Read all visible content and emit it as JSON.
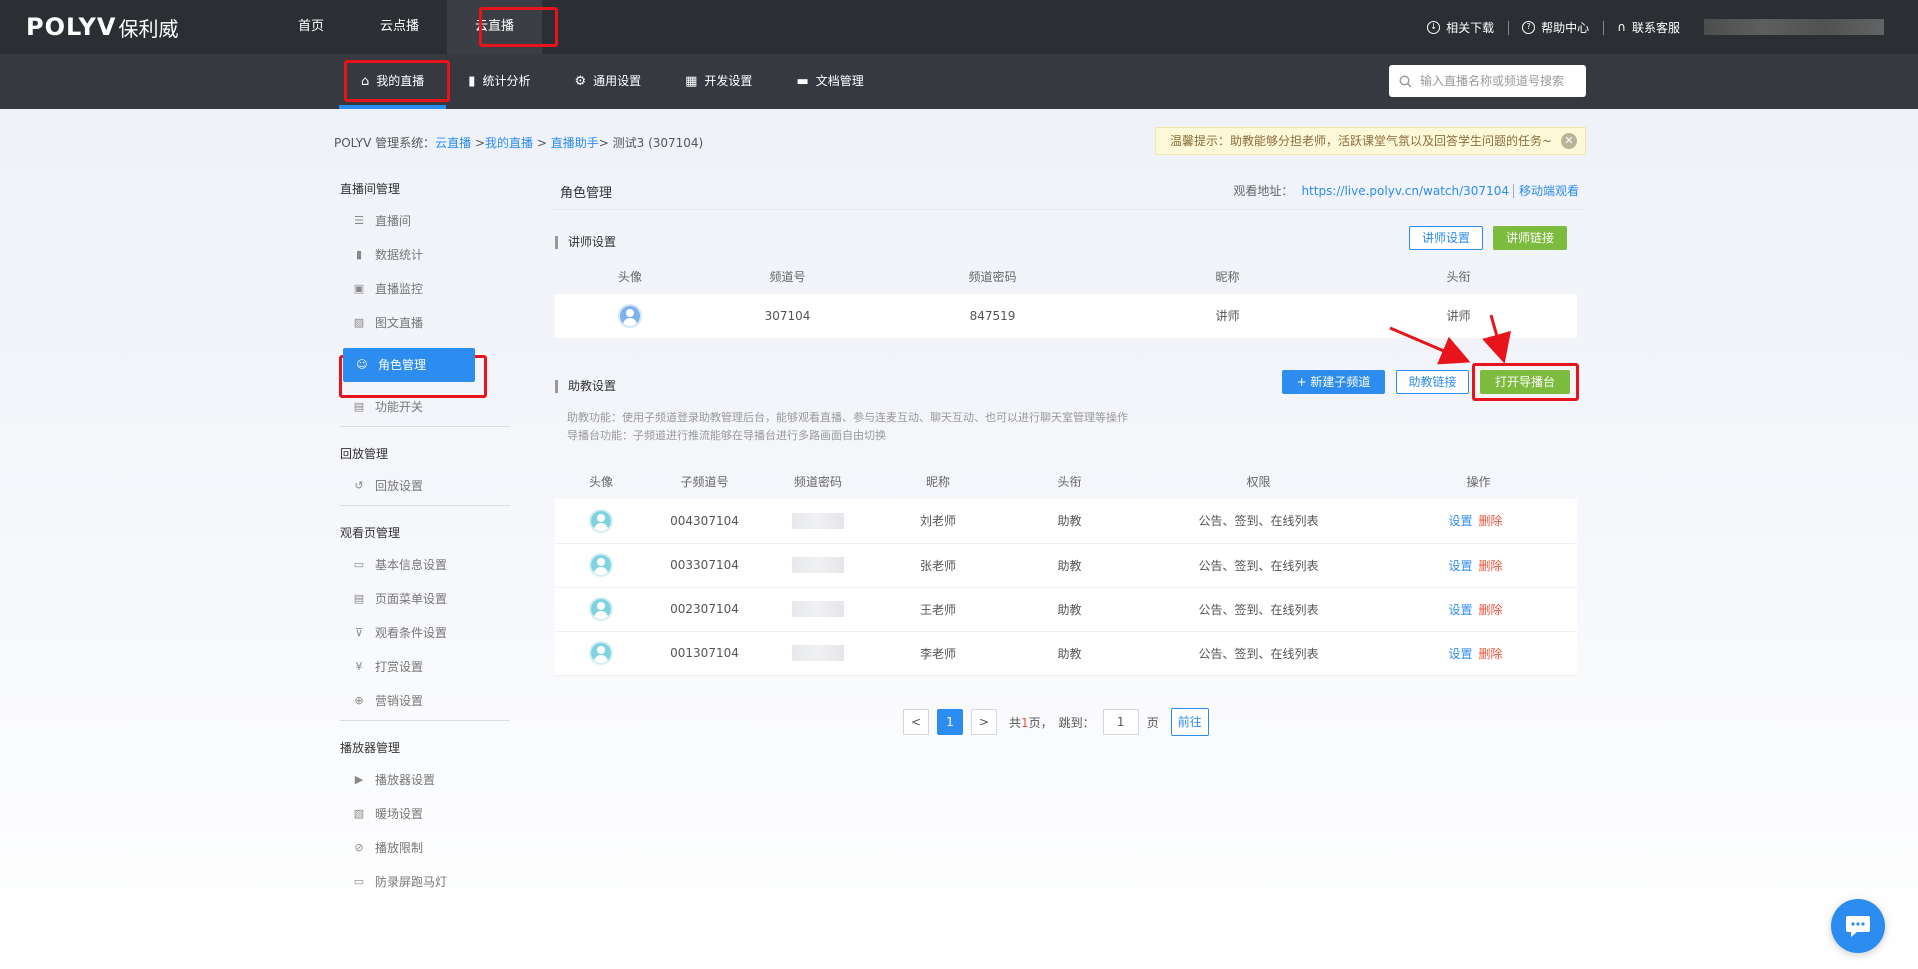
{
  "brand": {
    "logo": "POLYV",
    "logo_cn": "保利威"
  },
  "topnav": [
    "首页",
    "云点播",
    "云直播"
  ],
  "topright": {
    "download": "相关下载",
    "help": "帮助中心",
    "service": "联系客服"
  },
  "subnav": [
    "我的直播",
    "统计分析",
    "通用设置",
    "开发设置",
    "文档管理"
  ],
  "search": {
    "placeholder": "输入直播名称或频道号搜索"
  },
  "breadcrumb": {
    "prefix": "POLYV 管理系统：",
    "c1": "云直播",
    "sep1": " >",
    "c2": "我的直播",
    "sep2": " > ",
    "c3": "直播助手",
    "current": "> 测试3 (307104)"
  },
  "tip": {
    "text": "温馨提示：助教能够分担老师，活跃课堂气氛以及回答学生问题的任务~",
    "close": "✕"
  },
  "sidebar": {
    "groups": [
      {
        "title": "直播间管理",
        "items": [
          {
            "icon": "list-icon",
            "label": "直播间"
          },
          {
            "icon": "bar-chart-icon",
            "label": "数据统计"
          },
          {
            "icon": "monitor-icon",
            "label": "直播监控"
          },
          {
            "icon": "image-icon",
            "label": "图文直播"
          },
          {
            "icon": "user-icon",
            "label": "角色管理"
          },
          {
            "icon": "switch-icon",
            "label": "功能开关"
          }
        ]
      },
      {
        "title": "回放管理",
        "items": [
          {
            "icon": "replay-icon",
            "label": "回放设置"
          }
        ]
      },
      {
        "title": "观看页管理",
        "items": [
          {
            "icon": "info-icon",
            "label": "基本信息设置"
          },
          {
            "icon": "menu-icon",
            "label": "页面菜单设置"
          },
          {
            "icon": "filter-icon",
            "label": "观看条件设置"
          },
          {
            "icon": "yen-icon",
            "label": "打赏设置"
          },
          {
            "icon": "marketing-icon",
            "label": "营销设置"
          }
        ]
      },
      {
        "title": "播放器管理",
        "items": [
          {
            "icon": "player-icon",
            "label": "播放器设置"
          },
          {
            "icon": "warmup-icon",
            "label": "暖场设置"
          },
          {
            "icon": "eye-off-icon",
            "label": "播放限制"
          },
          {
            "icon": "marquee-icon",
            "label": "防录屏跑马灯"
          }
        ]
      }
    ]
  },
  "main": {
    "title": "角色管理",
    "watch_label": "观看地址：",
    "watch_url": "https://live.polyv.cn/watch/307104",
    "mobile_watch": "移动端观看",
    "lecturer": {
      "title": "讲师设置",
      "btn_settings": "讲师设置",
      "btn_link": "讲师链接",
      "headers": [
        "头像",
        "频道号",
        "频道密码",
        "昵称",
        "头衔"
      ],
      "row": {
        "channel": "307104",
        "password": "847519",
        "nickname": "讲师",
        "title": "讲师"
      }
    },
    "assistant": {
      "title": "助教设置",
      "btn_new": "+ 新建子频道",
      "btn_link": "助教链接",
      "btn_director": "打开导播台",
      "desc1": "助教功能：使用子频道登录助教管理后台，能够观看直播、参与连麦互动、聊天互动、也可以进行聊天室管理等操作",
      "desc2": "导播台功能：子频道进行推流能够在导播台进行多路画面自由切换",
      "headers": [
        "头像",
        "子频道号",
        "频道密码",
        "昵称",
        "头衔",
        "权限",
        "操作"
      ],
      "rows": [
        {
          "channel": "004307104",
          "nickname": "刘老师",
          "title": "助教",
          "perm": "公告、签到、在线列表",
          "set": "设置",
          "del": "删除"
        },
        {
          "channel": "003307104",
          "nickname": "张老师",
          "title": "助教",
          "perm": "公告、签到、在线列表",
          "set": "设置",
          "del": "删除"
        },
        {
          "channel": "002307104",
          "nickname": "王老师",
          "title": "助教",
          "perm": "公告、签到、在线列表",
          "set": "设置",
          "del": "删除"
        },
        {
          "channel": "001307104",
          "nickname": "李老师",
          "title": "助教",
          "perm": "公告、签到、在线列表",
          "set": "设置",
          "del": "删除"
        }
      ]
    }
  },
  "pager": {
    "prev": "<",
    "current": "1",
    "next": ">",
    "total_prefix": "共",
    "total": "1",
    "total_suffix": "页，",
    "jump_label": "跳到：",
    "jump_value": "1",
    "page_unit": "页",
    "go": "前往"
  },
  "colors": {
    "primary": "#2d8cf0",
    "green": "#7cbb3d",
    "highlight": "#e8141b",
    "topbar": "#2b2e33"
  }
}
